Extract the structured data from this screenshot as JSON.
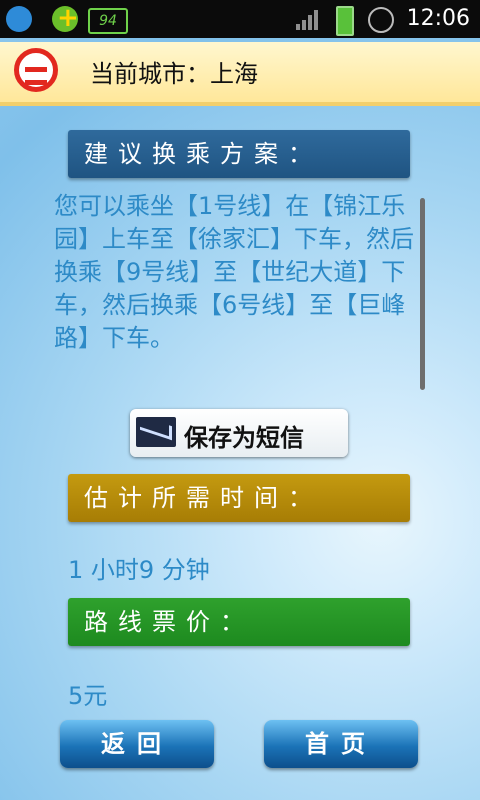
{
  "status_bar": {
    "time": "12:06",
    "battery_badge": "94",
    "icons": [
      "qq-icon",
      "plus-icon",
      "battery-badge-icon",
      "signal-icon",
      "battery-icon",
      "alarm-icon"
    ]
  },
  "header": {
    "title": "当前城市：上海",
    "logo_icon": "metro-logo-icon"
  },
  "plan": {
    "section_title": "建议换乘方案：",
    "text": "您可以乘坐【1号线】在【锦江乐园】上车至【徐家汇】下车，然后换乘【9号线】至【世纪大道】下车，然后换乘【6号线】至【巨峰路】下车。"
  },
  "actions": {
    "save_sms_label": "保存为短信",
    "save_sms_icon": "envelope-icon"
  },
  "estimate": {
    "section_title": "估计所需时间：",
    "value": "1 小时9 分钟"
  },
  "fare": {
    "section_title": "路线票价：",
    "value": "5元"
  },
  "nav": {
    "back_label": "返回",
    "home_label": "首页"
  },
  "colors": {
    "plan_header": "#2f6a9c",
    "time_header": "#c49a10",
    "price_header": "#2fa12d",
    "body_text": "#2d8ac7",
    "button_blue": "#1b73b7"
  }
}
